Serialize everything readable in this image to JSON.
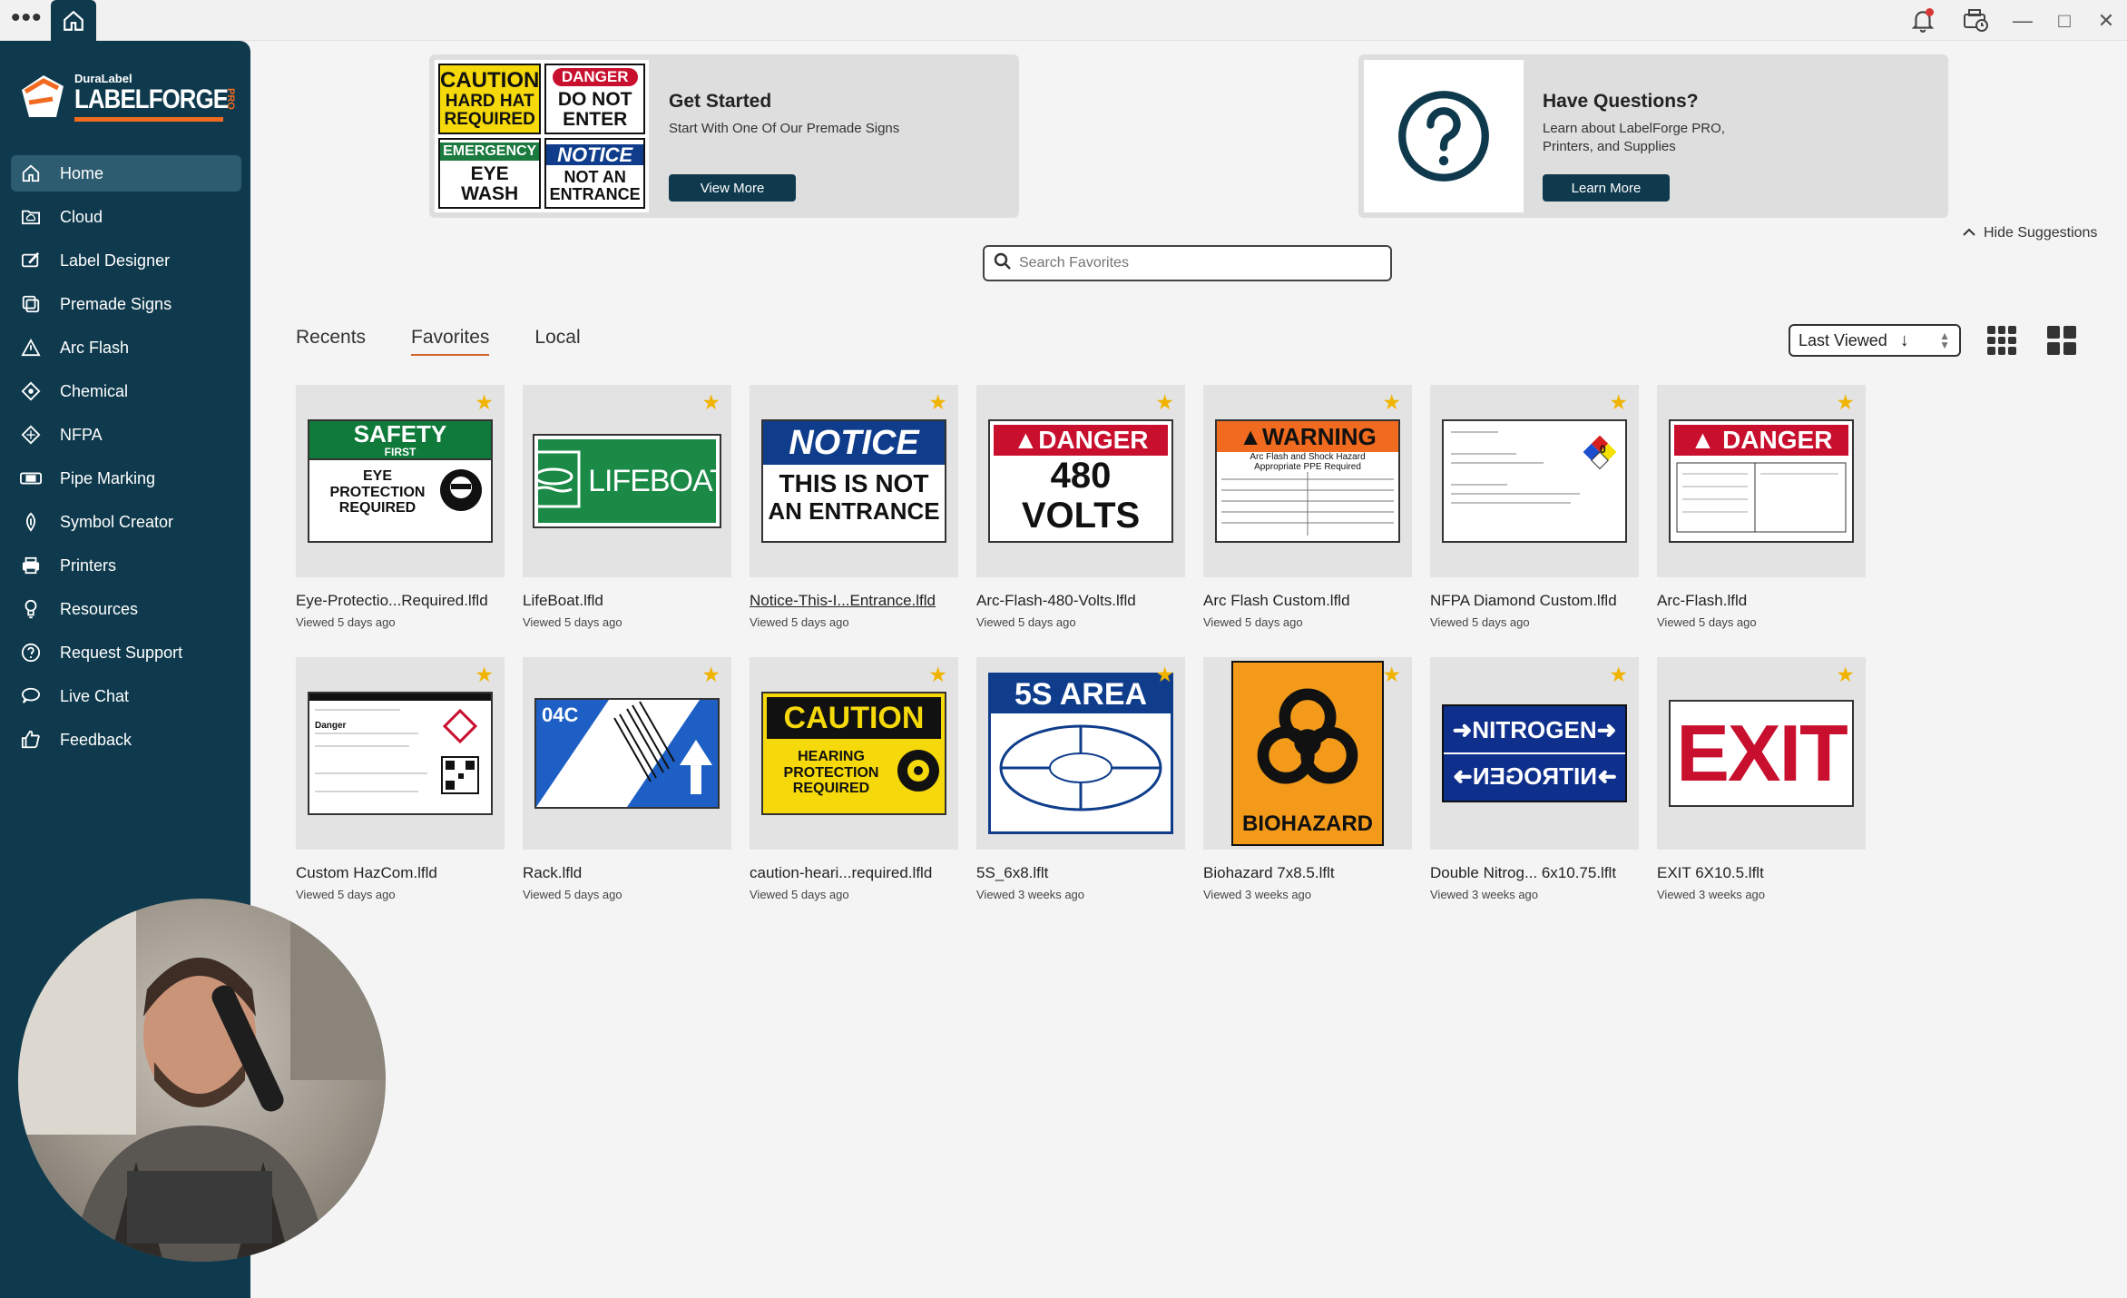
{
  "titlebar": {
    "menu_icon": "ellipsis-icon",
    "home_icon": "home-icon"
  },
  "brand": {
    "small": "DuraLabel",
    "name": "LABELFORGE",
    "suffix": "PRO"
  },
  "sidebar": {
    "items": [
      {
        "label": "Home",
        "icon": "home-icon"
      },
      {
        "label": "Cloud",
        "icon": "cloud-folder-icon"
      },
      {
        "label": "Label Designer",
        "icon": "label-designer-icon"
      },
      {
        "label": "Premade Signs",
        "icon": "premade-signs-icon"
      },
      {
        "label": "Arc Flash",
        "icon": "warning-triangle-icon"
      },
      {
        "label": "Chemical",
        "icon": "chemical-diamond-icon"
      },
      {
        "label": "NFPA",
        "icon": "nfpa-diamond-icon"
      },
      {
        "label": "Pipe Marking",
        "icon": "pipe-icon"
      },
      {
        "label": "Symbol Creator",
        "icon": "symbol-icon"
      },
      {
        "label": "Printers",
        "icon": "printer-icon"
      },
      {
        "label": "Resources",
        "icon": "lightbulb-icon"
      },
      {
        "label": "Request Support",
        "icon": "support-icon"
      },
      {
        "label": "Live Chat",
        "icon": "chat-icon"
      },
      {
        "label": "Feedback",
        "icon": "thumbs-up-icon"
      }
    ]
  },
  "suggestions": {
    "get_started": {
      "title": "Get Started",
      "subtitle": "Start With One Of Our Premade Signs",
      "button": "View More",
      "signs": [
        {
          "top": "CAUTION",
          "bottom": "HARD HAT REQUIRED"
        },
        {
          "top": "DANGER",
          "bottom": "DO NOT ENTER"
        },
        {
          "top": "EMERGENCY",
          "bottom": "EYE WASH"
        },
        {
          "top": "NOTICE",
          "bottom": "NOT AN ENTRANCE"
        }
      ]
    },
    "questions": {
      "title": "Have Questions?",
      "subtitle_line1": "Learn about LabelForge PRO,",
      "subtitle_line2": "Printers, and Supplies",
      "button": "Learn More"
    },
    "hide_label": "Hide Suggestions"
  },
  "search": {
    "placeholder": "Search Favorites"
  },
  "tabs": [
    {
      "label": "Recents"
    },
    {
      "label": "Favorites"
    },
    {
      "label": "Local"
    }
  ],
  "sort": {
    "label": "Last Viewed"
  },
  "files": [
    {
      "name": "Eye-Protectio...Required.lfld",
      "viewed": "Viewed 5 days ago",
      "sign": {
        "top": "SAFETY",
        "mid": "FIRST",
        "text": "EYE PROTECTION REQUIRED"
      }
    },
    {
      "name": "LifeBoat.lfld",
      "viewed": "Viewed 5 days ago",
      "sign": {
        "text": "LIFEBOAT"
      }
    },
    {
      "name": "Notice-This-I...Entrance.lfld",
      "viewed": "Viewed 5 days ago",
      "sign": {
        "top": "NOTICE",
        "line1": "THIS IS NOT",
        "line2": "AN ENTRANCE"
      }
    },
    {
      "name": "Arc-Flash-480-Volts.lfld",
      "viewed": "Viewed 5 days ago",
      "sign": {
        "top": "DANGER",
        "line1": "480",
        "line2": "VOLTS"
      }
    },
    {
      "name": "Arc Flash Custom.lfld",
      "viewed": "Viewed 5 days ago",
      "sign": {
        "top": "WARNING",
        "line1": "Arc Flash and Shock Hazard",
        "line2": "Appropriate PPE Required"
      }
    },
    {
      "name": "NFPA Diamond Custom.lfld",
      "viewed": "Viewed 5 days ago",
      "sign": {
        "text": "0"
      }
    },
    {
      "name": "Arc-Flash.lfld",
      "viewed": "Viewed 5 days ago",
      "sign": {
        "top": "DANGER"
      }
    },
    {
      "name": "Custom HazCom.lfld",
      "viewed": "Viewed 5 days ago",
      "sign": {
        "text": "Danger"
      }
    },
    {
      "name": "Rack.lfld",
      "viewed": "Viewed 5 days ago",
      "sign": {
        "text": "04C"
      }
    },
    {
      "name": "caution-heari...required.lfld",
      "viewed": "Viewed 5 days ago",
      "sign": {
        "top": "CAUTION",
        "text": "HEARING PROTECTION REQUIRED"
      }
    },
    {
      "name": "5S_6x8.lflt",
      "viewed": "Viewed 3 weeks ago",
      "sign": {
        "top": "5S AREA"
      }
    },
    {
      "name": "Biohazard 7x8.5.lflt",
      "viewed": "Viewed 3 weeks ago",
      "sign": {
        "text": "BIOHAZARD"
      }
    },
    {
      "name": "Double Nitrog... 6x10.75.lflt",
      "viewed": "Viewed 3 weeks ago",
      "sign": {
        "line1": "NITROGEN",
        "line2": "NITROGEN"
      }
    },
    {
      "name": "EXIT 6X10.5.lflt",
      "viewed": "Viewed 3 weeks ago",
      "sign": {
        "text": "EXIT"
      }
    }
  ],
  "colors": {
    "sidebar": "#0f3a4d",
    "accent": "#d0642a",
    "star": "#f0b400"
  }
}
